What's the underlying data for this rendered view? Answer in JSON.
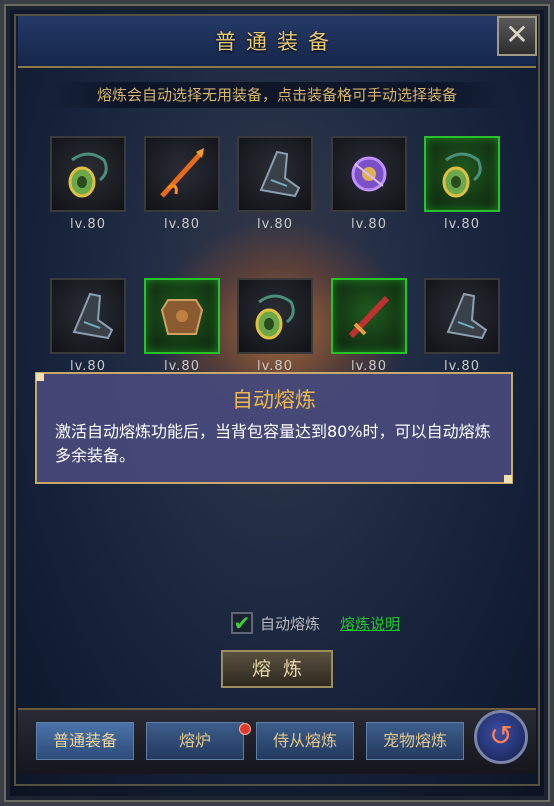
{
  "window": {
    "title": "普通装备",
    "close_glyph": "✕"
  },
  "hint": "熔炼会自动选择无用装备，点击装备格可手动选择装备",
  "equipment": [
    {
      "icon": "jade-pendant-icon",
      "level": "lv.80",
      "quality": "normal"
    },
    {
      "icon": "flame-spear-icon",
      "level": "lv.80",
      "quality": "normal"
    },
    {
      "icon": "boots-icon",
      "level": "lv.80",
      "quality": "normal"
    },
    {
      "icon": "amulet-icon",
      "level": "lv.80",
      "quality": "normal"
    },
    {
      "icon": "jade-pendant-icon",
      "level": "lv.80",
      "quality": "green"
    },
    {
      "icon": "boots-icon",
      "level": "lv.80",
      "quality": "normal"
    },
    {
      "icon": "armor-icon",
      "level": "lv.80",
      "quality": "green"
    },
    {
      "icon": "jade-pendant-icon",
      "level": "lv.80",
      "quality": "normal"
    },
    {
      "icon": "red-sword-icon",
      "level": "lv.80",
      "quality": "green"
    },
    {
      "icon": "boots-icon",
      "level": "lv.80",
      "quality": "normal"
    }
  ],
  "popup": {
    "title": "自动熔炼",
    "body": "激活自动熔炼功能后，当背包容量达到80%时，可以自动熔炼多余装备。"
  },
  "auto_smelt": {
    "checked": true,
    "check_glyph": "✔",
    "label": "自动熔炼",
    "explain_link": "熔炼说明"
  },
  "smelt_button": "熔炼",
  "tabs": [
    {
      "label": "普通装备",
      "active": true
    },
    {
      "label": "熔炉",
      "active": false,
      "badge": true
    },
    {
      "label": "侍从熔炼",
      "active": false
    },
    {
      "label": "宠物熔炼",
      "active": false
    }
  ],
  "back_glyph": "↺",
  "colors": {
    "title": "#e8c873",
    "hint": "#d7b46a",
    "green_frame": "#29c12b",
    "link": "#21c82c",
    "popup_title": "#f0b84a"
  }
}
